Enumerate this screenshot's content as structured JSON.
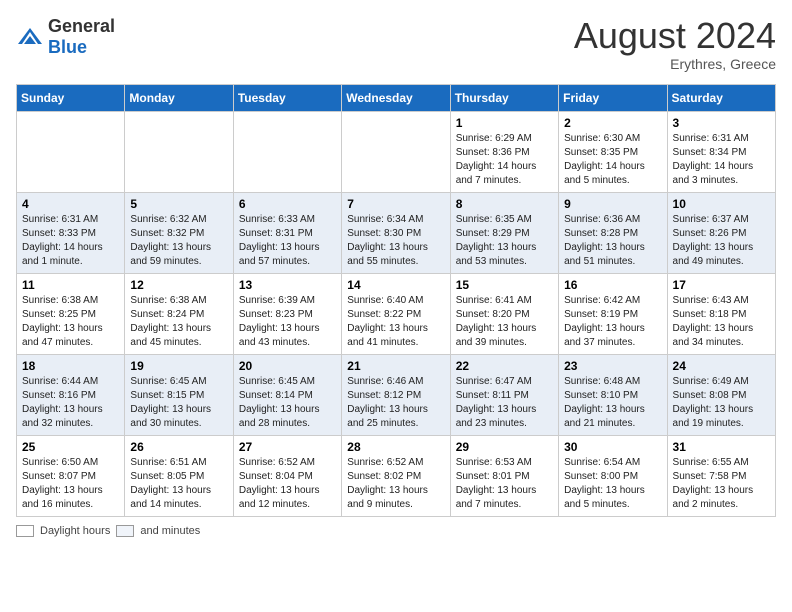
{
  "header": {
    "logo_general": "General",
    "logo_blue": "Blue",
    "month_year": "August 2024",
    "location": "Erythres, Greece"
  },
  "days_of_week": [
    "Sunday",
    "Monday",
    "Tuesday",
    "Wednesday",
    "Thursday",
    "Friday",
    "Saturday"
  ],
  "weeks": [
    [
      {
        "day": "",
        "info": ""
      },
      {
        "day": "",
        "info": ""
      },
      {
        "day": "",
        "info": ""
      },
      {
        "day": "",
        "info": ""
      },
      {
        "day": "1",
        "info": "Sunrise: 6:29 AM\nSunset: 8:36 PM\nDaylight: 14 hours\nand 7 minutes."
      },
      {
        "day": "2",
        "info": "Sunrise: 6:30 AM\nSunset: 8:35 PM\nDaylight: 14 hours\nand 5 minutes."
      },
      {
        "day": "3",
        "info": "Sunrise: 6:31 AM\nSunset: 8:34 PM\nDaylight: 14 hours\nand 3 minutes."
      }
    ],
    [
      {
        "day": "4",
        "info": "Sunrise: 6:31 AM\nSunset: 8:33 PM\nDaylight: 14 hours\nand 1 minute."
      },
      {
        "day": "5",
        "info": "Sunrise: 6:32 AM\nSunset: 8:32 PM\nDaylight: 13 hours\nand 59 minutes."
      },
      {
        "day": "6",
        "info": "Sunrise: 6:33 AM\nSunset: 8:31 PM\nDaylight: 13 hours\nand 57 minutes."
      },
      {
        "day": "7",
        "info": "Sunrise: 6:34 AM\nSunset: 8:30 PM\nDaylight: 13 hours\nand 55 minutes."
      },
      {
        "day": "8",
        "info": "Sunrise: 6:35 AM\nSunset: 8:29 PM\nDaylight: 13 hours\nand 53 minutes."
      },
      {
        "day": "9",
        "info": "Sunrise: 6:36 AM\nSunset: 8:28 PM\nDaylight: 13 hours\nand 51 minutes."
      },
      {
        "day": "10",
        "info": "Sunrise: 6:37 AM\nSunset: 8:26 PM\nDaylight: 13 hours\nand 49 minutes."
      }
    ],
    [
      {
        "day": "11",
        "info": "Sunrise: 6:38 AM\nSunset: 8:25 PM\nDaylight: 13 hours\nand 47 minutes."
      },
      {
        "day": "12",
        "info": "Sunrise: 6:38 AM\nSunset: 8:24 PM\nDaylight: 13 hours\nand 45 minutes."
      },
      {
        "day": "13",
        "info": "Sunrise: 6:39 AM\nSunset: 8:23 PM\nDaylight: 13 hours\nand 43 minutes."
      },
      {
        "day": "14",
        "info": "Sunrise: 6:40 AM\nSunset: 8:22 PM\nDaylight: 13 hours\nand 41 minutes."
      },
      {
        "day": "15",
        "info": "Sunrise: 6:41 AM\nSunset: 8:20 PM\nDaylight: 13 hours\nand 39 minutes."
      },
      {
        "day": "16",
        "info": "Sunrise: 6:42 AM\nSunset: 8:19 PM\nDaylight: 13 hours\nand 37 minutes."
      },
      {
        "day": "17",
        "info": "Sunrise: 6:43 AM\nSunset: 8:18 PM\nDaylight: 13 hours\nand 34 minutes."
      }
    ],
    [
      {
        "day": "18",
        "info": "Sunrise: 6:44 AM\nSunset: 8:16 PM\nDaylight: 13 hours\nand 32 minutes."
      },
      {
        "day": "19",
        "info": "Sunrise: 6:45 AM\nSunset: 8:15 PM\nDaylight: 13 hours\nand 30 minutes."
      },
      {
        "day": "20",
        "info": "Sunrise: 6:45 AM\nSunset: 8:14 PM\nDaylight: 13 hours\nand 28 minutes."
      },
      {
        "day": "21",
        "info": "Sunrise: 6:46 AM\nSunset: 8:12 PM\nDaylight: 13 hours\nand 25 minutes."
      },
      {
        "day": "22",
        "info": "Sunrise: 6:47 AM\nSunset: 8:11 PM\nDaylight: 13 hours\nand 23 minutes."
      },
      {
        "day": "23",
        "info": "Sunrise: 6:48 AM\nSunset: 8:10 PM\nDaylight: 13 hours\nand 21 minutes."
      },
      {
        "day": "24",
        "info": "Sunrise: 6:49 AM\nSunset: 8:08 PM\nDaylight: 13 hours\nand 19 minutes."
      }
    ],
    [
      {
        "day": "25",
        "info": "Sunrise: 6:50 AM\nSunset: 8:07 PM\nDaylight: 13 hours\nand 16 minutes."
      },
      {
        "day": "26",
        "info": "Sunrise: 6:51 AM\nSunset: 8:05 PM\nDaylight: 13 hours\nand 14 minutes."
      },
      {
        "day": "27",
        "info": "Sunrise: 6:52 AM\nSunset: 8:04 PM\nDaylight: 13 hours\nand 12 minutes."
      },
      {
        "day": "28",
        "info": "Sunrise: 6:52 AM\nSunset: 8:02 PM\nDaylight: 13 hours\nand 9 minutes."
      },
      {
        "day": "29",
        "info": "Sunrise: 6:53 AM\nSunset: 8:01 PM\nDaylight: 13 hours\nand 7 minutes."
      },
      {
        "day": "30",
        "info": "Sunrise: 6:54 AM\nSunset: 8:00 PM\nDaylight: 13 hours\nand 5 minutes."
      },
      {
        "day": "31",
        "info": "Sunrise: 6:55 AM\nSunset: 7:58 PM\nDaylight: 13 hours\nand 2 minutes."
      }
    ]
  ],
  "legend": {
    "daylight_label": "Daylight hours",
    "and_minutes_label": "and minutes"
  }
}
